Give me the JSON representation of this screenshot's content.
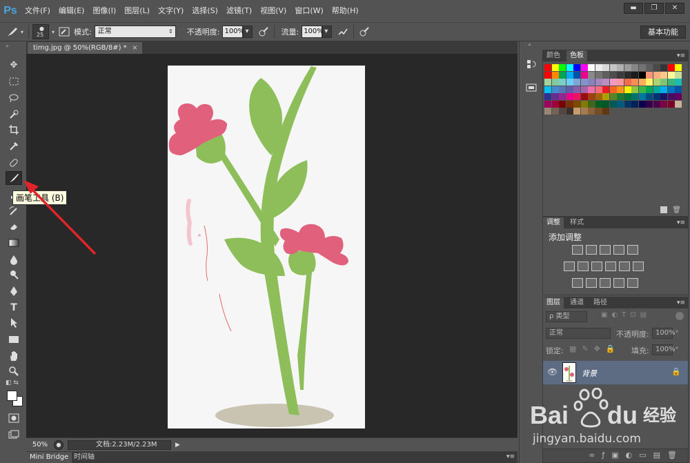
{
  "app": {
    "logo": "Ps"
  },
  "menu": [
    "文件(F)",
    "编辑(E)",
    "图像(I)",
    "图层(L)",
    "文字(Y)",
    "选择(S)",
    "滤镜(T)",
    "视图(V)",
    "窗口(W)",
    "帮助(H)"
  ],
  "window_buttons": [
    "▬",
    "❐",
    "✕"
  ],
  "options": {
    "brush_size": "25",
    "mode_label": "模式:",
    "mode_value": "正常",
    "opacity_label": "不透明度:",
    "opacity_value": "100%",
    "flow_label": "流量:",
    "flow_value": "100%",
    "workspace": "基本功能"
  },
  "document": {
    "tab_title": "timg.jpg @ 50%(RGB/8#) *",
    "close": "×",
    "zoom": "50%",
    "doc_size": "文档:2.23M/2.23M"
  },
  "tooltip": "画笔工具 (B)",
  "bottom_tabs": [
    "Mini Bridge",
    "时间轴"
  ],
  "panels": {
    "color": {
      "tabs": [
        "颜色",
        "色板"
      ],
      "active": 1
    },
    "adjust": {
      "tabs": [
        "调整",
        "样式"
      ],
      "active": 0,
      "title": "添加调整"
    },
    "layers": {
      "tabs": [
        "图层",
        "通道",
        "路径"
      ],
      "active": 0,
      "filter": "ρ 类型",
      "blend": "正常",
      "opacity_label": "不透明度:",
      "opacity_value": "100%",
      "lock_label": "锁定:",
      "fill_label": "填充:",
      "fill_value": "100%",
      "layer_name": "背景"
    }
  },
  "swatch_colors": [
    "#ff0000",
    "#ffff00",
    "#00ff00",
    "#00ffff",
    "#0000ff",
    "#ff00ff",
    "#ffffff",
    "#ececec",
    "#d9d9d9",
    "#c4c4c4",
    "#b0b0b0",
    "#9b9b9b",
    "#878787",
    "#737373",
    "#5e5e5e",
    "#4a4a4a",
    "#363636",
    "#ff0000",
    "#ffff00",
    "#ff0000",
    "#ff8800",
    "#00a651",
    "#00aeef",
    "#0054a6",
    "#ec008c",
    "#898989",
    "#737373",
    "#5f5f5f",
    "#4d4d4d",
    "#3b3b3b",
    "#2b2b2b",
    "#1c1c1c",
    "#000000",
    "#f7977a",
    "#f9ad81",
    "#fdc68a",
    "#fff79a",
    "#c4df9b",
    "#a3d39c",
    "#82ca9d",
    "#7bcdc8",
    "#6ecff6",
    "#7ea7d8",
    "#8493ca",
    "#8882be",
    "#a187be",
    "#bc8dbf",
    "#f49ac2",
    "#f6989d",
    "#f26c4f",
    "#f68e55",
    "#fbaf5d",
    "#fff467",
    "#acd372",
    "#7cc576",
    "#3bb878",
    "#1abbb4",
    "#00bff3",
    "#438ccb",
    "#5574b9",
    "#605ca8",
    "#855fa8",
    "#a763a8",
    "#f06eaa",
    "#f26d7d",
    "#ed1c24",
    "#f26522",
    "#f7941d",
    "#fff200",
    "#8dc73f",
    "#39b54a",
    "#00a651",
    "#00a99d",
    "#00aeef",
    "#0072bc",
    "#0054a6",
    "#2e3192",
    "#662d91",
    "#92278f",
    "#ec008c",
    "#ed145b",
    "#9e0b0f",
    "#a0410d",
    "#a36209",
    "#aba000",
    "#598527",
    "#1a7b30",
    "#007236",
    "#00746b",
    "#0076a3",
    "#004b80",
    "#003471",
    "#1b1464",
    "#440e62",
    "#630460",
    "#9e005d",
    "#9e0039",
    "#790000",
    "#7b2e00",
    "#7d4900",
    "#827b00",
    "#406618",
    "#005e20",
    "#005826",
    "#005952",
    "#005b7f",
    "#003663",
    "#002157",
    "#0d004c",
    "#32004b",
    "#4b0049",
    "#7b0046",
    "#7a0026",
    "#c7b299",
    "#998675",
    "#736357",
    "#534741",
    "#37302d",
    "#c69c6d",
    "#a67c52",
    "#8c6239",
    "#754c24",
    "#603913"
  ]
}
